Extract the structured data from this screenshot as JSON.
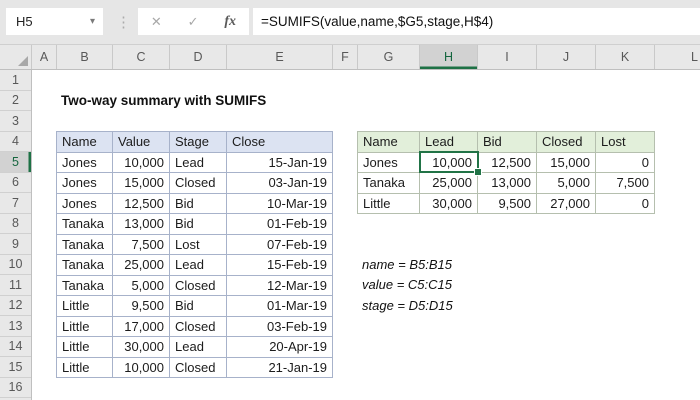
{
  "formula_bar": {
    "cell_reference": "H5",
    "dropdown_icon": "▾",
    "separator_icon": "⋮",
    "cancel_icon": "✕",
    "enter_icon": "✓",
    "fx_icon": "fx",
    "formula": "=SUMIFS(value,name,$G5,stage,H$4)"
  },
  "grid": {
    "column_letters": [
      "A",
      "B",
      "C",
      "D",
      "E",
      "F",
      "G",
      "H",
      "I",
      "J",
      "K",
      "L"
    ],
    "row_numbers": [
      "1",
      "2",
      "3",
      "4",
      "5",
      "6",
      "7",
      "8",
      "9",
      "10",
      "11",
      "12",
      "13",
      "14",
      "15",
      "16"
    ],
    "selected_cell": "H5",
    "selected_column": "H",
    "selected_row": "5"
  },
  "sheet": {
    "title": "Two-way summary with SUMIFS",
    "source_table": {
      "headers": [
        "Name",
        "Value",
        "Stage",
        "Close"
      ],
      "rows": [
        [
          "Jones",
          "10,000",
          "Lead",
          "15-Jan-19"
        ],
        [
          "Jones",
          "15,000",
          "Closed",
          "03-Jan-19"
        ],
        [
          "Jones",
          "12,500",
          "Bid",
          "10-Mar-19"
        ],
        [
          "Tanaka",
          "13,000",
          "Bid",
          "01-Feb-19"
        ],
        [
          "Tanaka",
          "7,500",
          "Lost",
          "07-Feb-19"
        ],
        [
          "Tanaka",
          "25,000",
          "Lead",
          "15-Feb-19"
        ],
        [
          "Tanaka",
          "5,000",
          "Closed",
          "12-Mar-19"
        ],
        [
          "Little",
          "9,500",
          "Bid",
          "01-Mar-19"
        ],
        [
          "Little",
          "17,000",
          "Closed",
          "03-Feb-19"
        ],
        [
          "Little",
          "30,000",
          "Lead",
          "20-Apr-19"
        ],
        [
          "Little",
          "10,000",
          "Closed",
          "21-Jan-19"
        ]
      ]
    },
    "summary_table": {
      "headers": [
        "Name",
        "Lead",
        "Bid",
        "Closed",
        "Lost"
      ],
      "rows": [
        [
          "Jones",
          "10,000",
          "12,500",
          "15,000",
          "0"
        ],
        [
          "Tanaka",
          "25,000",
          "13,000",
          "5,000",
          "7,500"
        ],
        [
          "Little",
          "30,000",
          "9,500",
          "27,000",
          "0"
        ]
      ]
    },
    "notes": [
      "name = B5:B15",
      "value = C5:C15",
      "stage = D5:D15"
    ]
  },
  "colors": {
    "selection_green": "#217346",
    "source_header_fill": "#dce3f2",
    "summary_header_fill": "#e2efda",
    "selected_header_fill": "#d2d2d2"
  }
}
